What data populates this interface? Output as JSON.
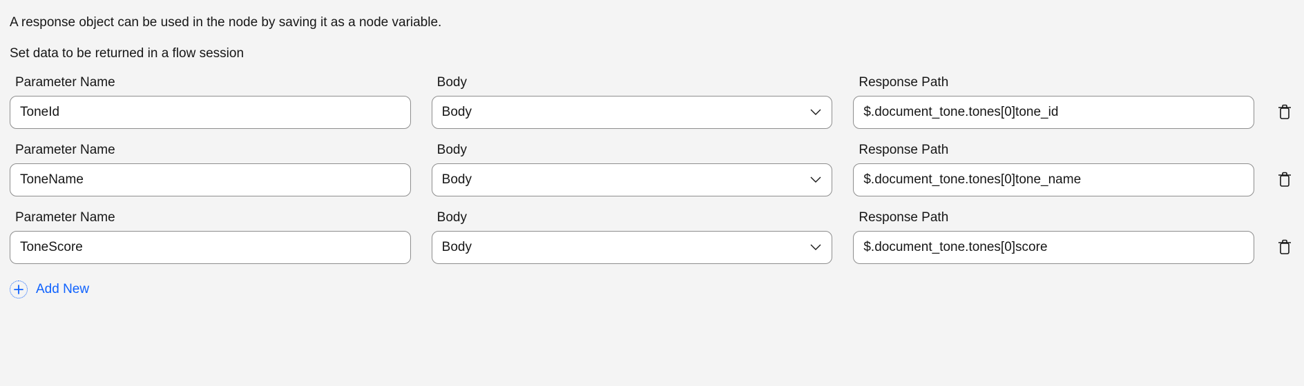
{
  "description": "A response object can be used in the node by saving it as a node variable.",
  "subheading": "Set data to be returned in a flow session",
  "labels": {
    "parameter_name": "Parameter Name",
    "body": "Body",
    "response_path": "Response Path"
  },
  "rows": [
    {
      "parameter_name": "ToneId",
      "body": "Body",
      "response_path": "$.document_tone.tones[0]tone_id"
    },
    {
      "parameter_name": "ToneName",
      "body": "Body",
      "response_path": "$.document_tone.tones[0]tone_name"
    },
    {
      "parameter_name": "ToneScore",
      "body": "Body",
      "response_path": "$.document_tone.tones[0]score"
    }
  ],
  "add_new_label": "Add New"
}
